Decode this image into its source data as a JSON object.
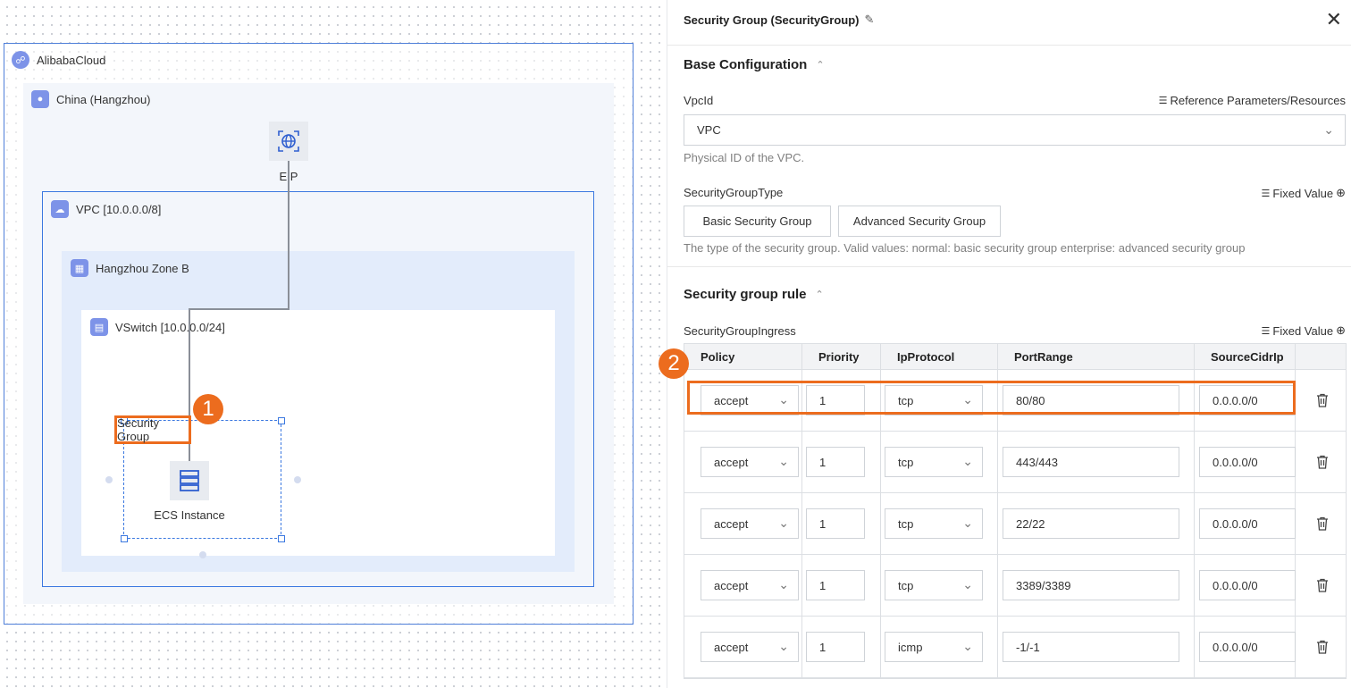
{
  "canvas": {
    "cloud_label": "AlibabaCloud",
    "region_label": "China (Hangzhou)",
    "eip_label": "EIP",
    "vpc_label": "VPC [10.0.0.0/8]",
    "zone_label": "Hangzhou Zone B",
    "vswitch_label": "VSwitch [10.0.0.0/24]",
    "security_group_label": "Security Group",
    "ecs_label": "ECS Instance",
    "badge1": "1",
    "badge2": "2"
  },
  "panel": {
    "title": "Security Group (SecurityGroup)",
    "sections": {
      "base": "Base Configuration",
      "rules": "Security group rule"
    },
    "vpcid": {
      "label": "VpcId",
      "ref": "Reference Parameters/Resources",
      "value": "VPC",
      "help": "Physical ID of the VPC."
    },
    "sgtype": {
      "label": "SecurityGroupType",
      "mode": "Fixed Value",
      "options": [
        "Basic Security Group",
        "Advanced Security Group"
      ],
      "help": "The type of the security group. Valid values: normal: basic security group enterprise: advanced security group"
    },
    "ingress": {
      "label": "SecurityGroupIngress",
      "mode": "Fixed Value",
      "columns": [
        "Policy",
        "Priority",
        "IpProtocol",
        "PortRange",
        "SourceCidrIp"
      ],
      "rows": [
        {
          "policy": "accept",
          "priority": "1",
          "protocol": "tcp",
          "port": "80/80",
          "cidr": "0.0.0.0/0"
        },
        {
          "policy": "accept",
          "priority": "1",
          "protocol": "tcp",
          "port": "443/443",
          "cidr": "0.0.0.0/0"
        },
        {
          "policy": "accept",
          "priority": "1",
          "protocol": "tcp",
          "port": "22/22",
          "cidr": "0.0.0.0/0"
        },
        {
          "policy": "accept",
          "priority": "1",
          "protocol": "tcp",
          "port": "3389/3389",
          "cidr": "0.0.0.0/0"
        },
        {
          "policy": "accept",
          "priority": "1",
          "protocol": "icmp",
          "port": "-1/-1",
          "cidr": "0.0.0.0/0"
        }
      ]
    }
  },
  "colors": {
    "accent": "#3b78e0",
    "highlight": "#ec6c1e",
    "icon_bg": "#7d93e8"
  },
  "icons": {
    "cloud": "alibaba-cloud-icon",
    "region": "location-pin-icon",
    "vpc": "cloud-network-icon",
    "zone": "zone-icon",
    "vswitch": "switch-icon",
    "eip": "globe-icon",
    "ecs": "server-icon",
    "edit": "pencil-icon",
    "close": "close-icon",
    "trash": "trash-icon",
    "list": "list-icon",
    "add": "plus-circle-icon",
    "chevron": "chevron-down-icon"
  }
}
